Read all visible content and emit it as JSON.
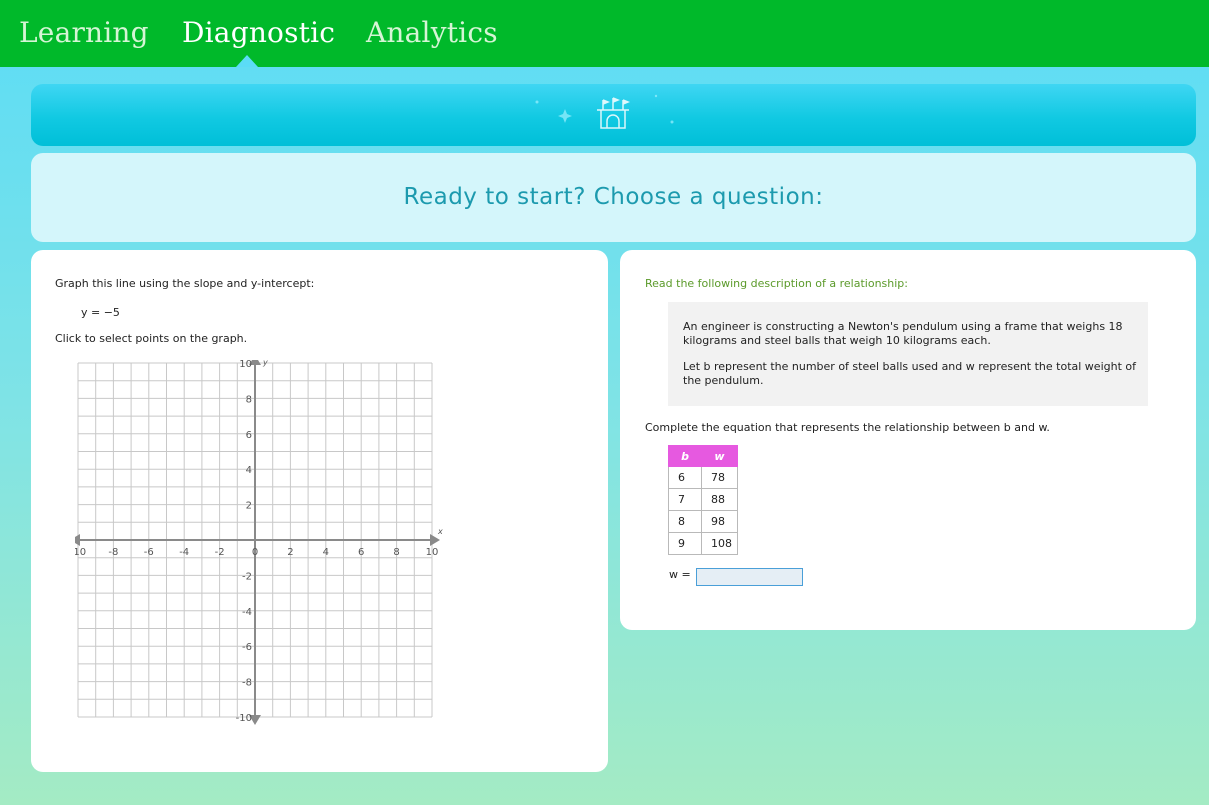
{
  "nav": {
    "tabs": [
      {
        "label": "Learning",
        "active": false
      },
      {
        "label": "Diagnostic",
        "active": true
      },
      {
        "label": "Analytics",
        "active": false
      }
    ],
    "bar_color": "#00b92a"
  },
  "banner": {
    "icon": "castle-icon"
  },
  "header": {
    "title": "Ready to start? Choose a question:"
  },
  "question1": {
    "prompt": "Graph this line using the slope and y-intercept:",
    "equation": "y = −5",
    "instruction": "Click to select points on the graph.",
    "graph": {
      "x_range": [
        -10,
        10
      ],
      "y_range": [
        -10,
        10
      ],
      "x_tick_labels": [
        "-10",
        "-8",
        "-6",
        "-4",
        "-2",
        "0",
        "2",
        "4",
        "6",
        "8",
        "10"
      ],
      "y_tick_labels": [
        "10",
        "8",
        "6",
        "4",
        "2",
        "-2",
        "-4",
        "-6",
        "-8",
        "-10"
      ],
      "x_axis_label": "x",
      "y_axis_label": "y"
    }
  },
  "question2": {
    "prompt": "Read the following description of a relationship:",
    "description_1": "An engineer is constructing a Newton's pendulum using a frame that weighs 18 kilograms and steel balls that weigh 10 kilograms each.",
    "description_2": "Let b represent the number of steel balls used and w represent the total weight of the pendulum.",
    "instruction": "Complete the equation that represents the relationship between b and w.",
    "table": {
      "headers": [
        "b",
        "w"
      ],
      "rows": [
        [
          "6",
          "78"
        ],
        [
          "7",
          "88"
        ],
        [
          "8",
          "98"
        ],
        [
          "9",
          "108"
        ]
      ]
    },
    "answer_label": "w =",
    "answer_value": ""
  }
}
